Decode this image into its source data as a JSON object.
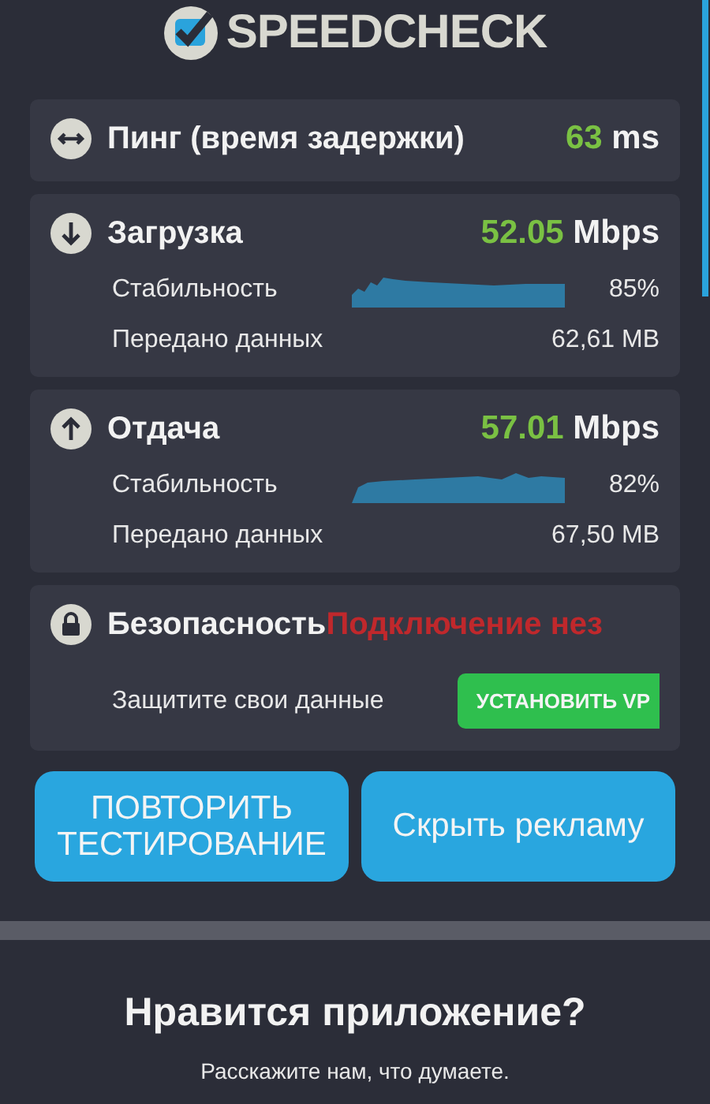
{
  "app": {
    "logo": "SPEEDCHECK"
  },
  "ping": {
    "label": "Пинг (время задержки)",
    "value": "63",
    "unit": "ms"
  },
  "tests": [
    {
      "kind": "download",
      "label": "Загрузка",
      "value": "52.05",
      "unit": "Mbps",
      "stability_label": "Стабильность",
      "stability": "85%",
      "data_label": "Передано данных",
      "data": "62,61 MB"
    },
    {
      "kind": "upload",
      "label": "Отдача",
      "value": "57.01",
      "unit": "Mbps",
      "stability_label": "Стабильность",
      "stability": "82%",
      "data_label": "Передано данных",
      "data": "67,50 MB"
    }
  ],
  "security": {
    "label": "Безопасность",
    "status": "Подключение нез",
    "prompt": "Защитите свои данные",
    "button": "УСТАНОВИТЬ VP"
  },
  "buttons": [
    "ПОВТОРИТЬ ТЕСТИРОВАНИЕ",
    "Скрыть рекламу"
  ],
  "rating": {
    "title": "Нравится приложение?",
    "subtitle": "Расскажите нам, что думаете."
  }
}
